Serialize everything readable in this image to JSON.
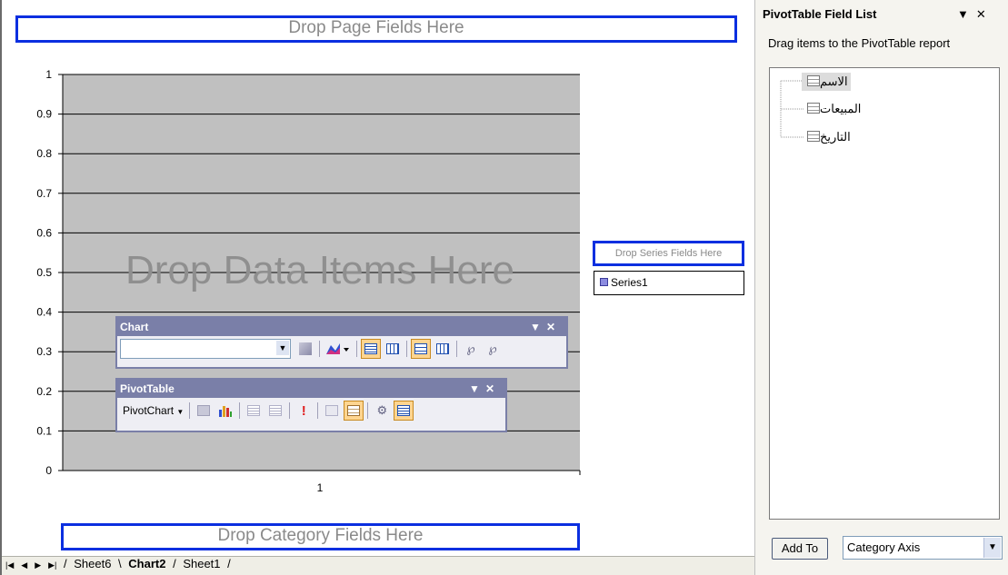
{
  "dropzones": {
    "page": "Drop Page Fields Here",
    "data": "Drop Data Items Here",
    "series": "Drop Series Fields Here",
    "category": "Drop Category Fields Here"
  },
  "chart_data": {
    "type": "bar",
    "categories": [
      "1"
    ],
    "series": [
      {
        "name": "Series1",
        "values": []
      }
    ],
    "ylim": [
      0,
      1
    ],
    "yticks": [
      "0",
      "0.1",
      "0.2",
      "0.3",
      "0.4",
      "0.5",
      "0.6",
      "0.7",
      "0.8",
      "0.9",
      "1"
    ],
    "grid": true,
    "plot_background": "#c0c0c0"
  },
  "legend": {
    "series_name": "Series1"
  },
  "chart_toolbar": {
    "title": "Chart",
    "chart_object_value": ""
  },
  "pivot_toolbar": {
    "title": "PivotTable",
    "pivotchart_menu": "PivotChart"
  },
  "sheet_tabs": [
    {
      "label": "Sheet6",
      "active": false
    },
    {
      "label": "Chart2",
      "active": true
    },
    {
      "label": "Sheet1",
      "active": false
    }
  ],
  "field_list": {
    "title": "PivotTable Field List",
    "hint": "Drag items to the PivotTable report",
    "fields": [
      "الاسم",
      "المبيعات",
      "التاريخ"
    ],
    "add_button": "Add To",
    "area_value": "Category Axis"
  },
  "colors": {
    "dropzone_border": "#0b2fe0",
    "toolbar_title": "#7a7fa8",
    "active_button": "#ffd590"
  }
}
